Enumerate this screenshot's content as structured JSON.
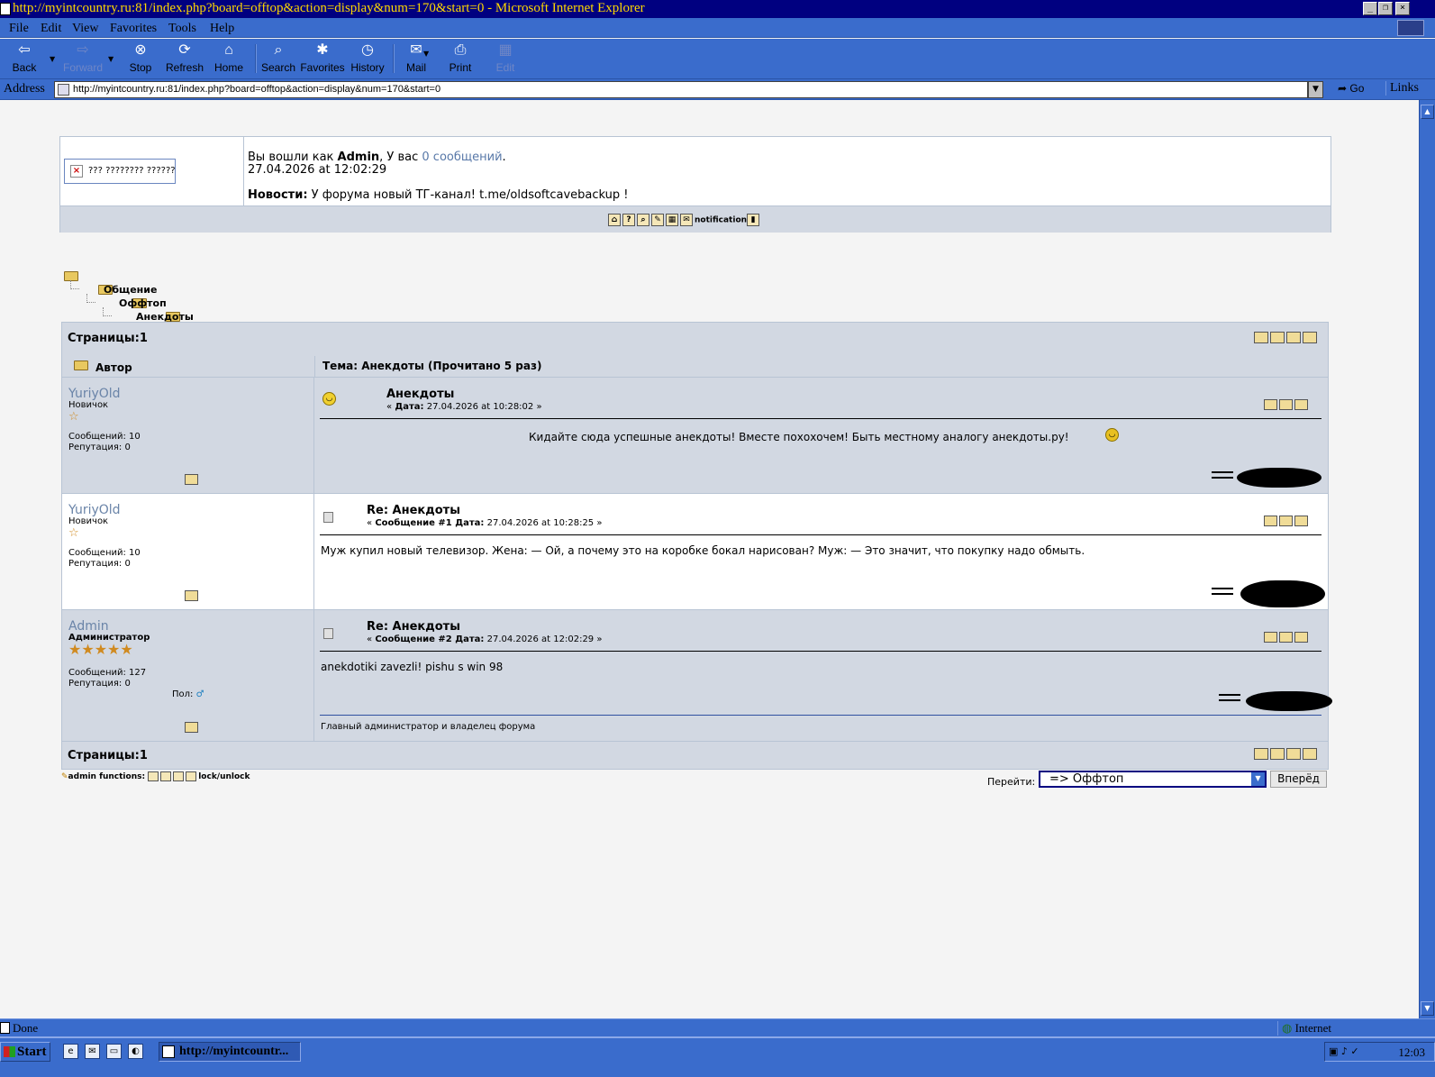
{
  "window": {
    "title": "http://myintcountry.ru:81/index.php?board=offtop&action=display&num=170&start=0 - Microsoft Internet Explorer"
  },
  "menu": [
    "File",
    "Edit",
    "View",
    "Favorites",
    "Tools",
    "Help"
  ],
  "toolbar": {
    "back": "Back",
    "forward": "Forward",
    "stop": "Stop",
    "refresh": "Refresh",
    "home": "Home",
    "search": "Search",
    "favorites": "Favorites",
    "history": "History",
    "mail": "Mail",
    "print": "Print",
    "edit": "Edit"
  },
  "address": {
    "label": "Address",
    "url": "http://myintcountry.ru:81/index.php?board=offtop&action=display&num=170&start=0",
    "go": "Go",
    "links": "Links"
  },
  "header": {
    "broken_image_alt": "??? ???????? ??????",
    "logged_prefix": "Вы вошли как",
    "username": "Admin",
    "msgs_prefix": ", У вас",
    "msgs_link": "0 сообщений",
    "date": "27.04.2026 at 12:02:29",
    "news_label": "Новости:",
    "news_text": "У форума новый ТГ-канал! t.me/oldsoftcavebackup !",
    "notification": "notification"
  },
  "breadcrumb": [
    "Общение",
    "Оффтоп",
    "Анекдоты"
  ],
  "pages_label": "Страницы:",
  "pages_value": "1",
  "columns": {
    "author": "Автор",
    "topic": "Тема: Анекдоты  (Прочитано 5 раз)"
  },
  "posts": [
    {
      "author": "YuriyOld",
      "rank": "Новичок",
      "stars": "☆",
      "posts_stat": "Сообщений: 10",
      "rep_stat": "Репутация: 0",
      "subject": "Анекдоты",
      "meta_prefix": "«",
      "meta_label": "Дата:",
      "meta_value": "27.04.2026 at 10:28:02 »",
      "body": "Кидайте сюда успешные анекдоты! Вместе похохочем! Быть местному аналогу анекдоты.ру!"
    },
    {
      "author": "YuriyOld",
      "rank": "Новичок",
      "stars": "☆",
      "posts_stat": "Сообщений: 10",
      "rep_stat": "Репутация: 0",
      "subject": "Re: Анекдоты",
      "meta_prefix": "«",
      "meta_label": "Сообщение #1 Дата:",
      "meta_value": "27.04.2026 at 10:28:25 »",
      "body": "Муж купил новый телевизор. Жена: — Ой, а почему это на коробке бокал нарисован? Муж: — Это значит, что покупку надо обмыть."
    },
    {
      "author": "Admin",
      "rank": "Администратор",
      "stars": "★★★★★",
      "posts_stat": "Сообщений: 127",
      "rep_stat": "Репутация: 0",
      "gender_label": "Пол:",
      "subject": "Re: Анекдоты",
      "meta_prefix": "«",
      "meta_label": "Сообщение #2 Дата:",
      "meta_value": "27.04.2026 at 12:02:29 »",
      "body": "anekdotiki zavezli! pishu s win 98",
      "signature": "Главный администратор и владелец форума"
    }
  ],
  "footer": {
    "admin_functions": "admin functions:",
    "lock_unlock": "lock/unlock",
    "goto_label": "Перейти:",
    "goto_value": "=> Оффтоп",
    "goto_button": "Вперёд"
  },
  "status": {
    "text": "Done",
    "zone": "Internet"
  },
  "taskbar": {
    "start": "Start",
    "item": "http://myintcountr...",
    "clock": "12:03"
  },
  "colors": {
    "titlebar": "#000080",
    "chrome": "#3a6ccc",
    "forum_bg": "#d2d8e2",
    "username": "#6a84a8"
  }
}
